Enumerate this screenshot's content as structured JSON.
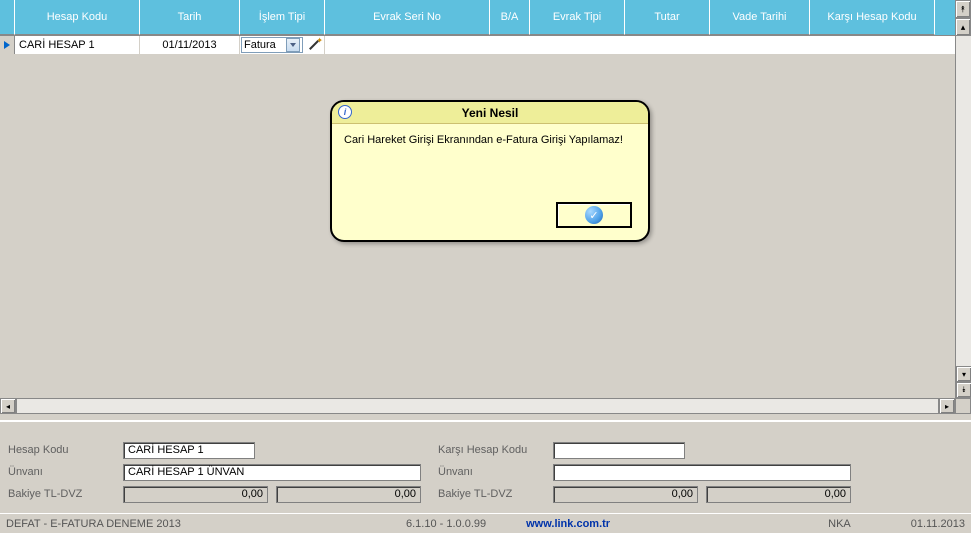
{
  "grid": {
    "headers": [
      "Hesap Kodu",
      "Tarih",
      "İşlem Tipi",
      "Evrak Seri No",
      "B/A",
      "Evrak Tipi",
      "Tutar",
      "Vade Tarihi",
      "Karşı Hesap Kodu"
    ],
    "widths": [
      125,
      100,
      85,
      165,
      40,
      95,
      85,
      100,
      125
    ],
    "row": {
      "hesap_kodu": "CARİ HESAP 1",
      "tarih": "01/11/2013",
      "islem_tipi": "Fatura"
    }
  },
  "dialog": {
    "title": "Yeni Nesil",
    "message": "Cari Hareket Girişi Ekranından e-Fatura Girişi Yapılamaz!"
  },
  "info": {
    "labels": {
      "hesap_kodu": "Hesap Kodu",
      "unvani": "Ünvanı",
      "bakiye": "Bakiye TL-DVZ",
      "karsi_hesap_kodu": "Karşı Hesap Kodu",
      "unvani2": "Ünvanı",
      "bakiye2": "Bakiye TL-DVZ"
    },
    "values": {
      "hesap_kodu": "CARİ HESAP 1",
      "unvani": "CARİ HESAP 1 ÜNVAN",
      "bakiye_tl": "0,00",
      "bakiye_dvz": "0,00",
      "karsi_hesap_kodu": "",
      "unvani2": "",
      "bakiye2_tl": "0,00",
      "bakiye2_dvz": "0,00"
    }
  },
  "status": {
    "left": "DEFAT - E-FATURA DENEME 2013",
    "version": "6.1.10 - 1.0.0.99",
    "link": "www.link.com.tr",
    "user": "NKA",
    "date": "01.11.2013"
  }
}
